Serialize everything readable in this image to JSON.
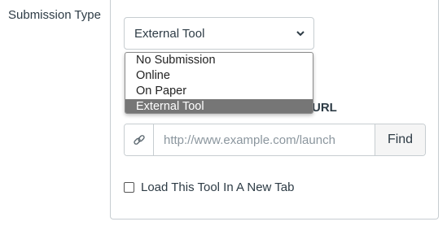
{
  "form": {
    "submission_type_label": "Submission Type",
    "select": {
      "value": "External Tool",
      "options": [
        "No Submission",
        "Online",
        "On Paper",
        "External Tool"
      ],
      "selected_index": 3,
      "chevron_icon": "chevron-down-icon"
    },
    "url_label_visible": "URL",
    "url_input": {
      "placeholder": "http://www.example.com/launch",
      "value": "",
      "addon_icon": "link-icon"
    },
    "find_button_label": "Find",
    "new_tab_checkbox": {
      "label": "Load This Tool In A New Tab",
      "checked": false
    }
  }
}
